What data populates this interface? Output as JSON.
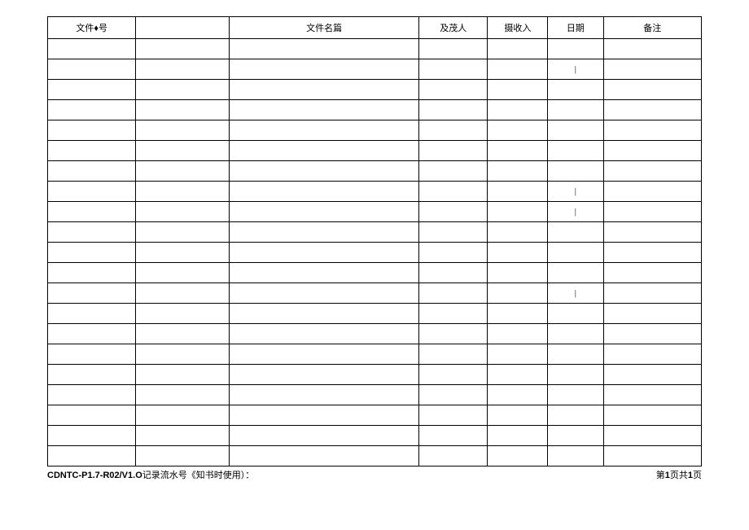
{
  "headers": {
    "fileno": "文件♦号",
    "spacer": "",
    "filename": "文件名篇",
    "jimao": "及茂人",
    "receiver": "摄收入",
    "date": "日期",
    "remark": "备注"
  },
  "rows": [
    {
      "fileno": "",
      "spacer": "",
      "filename": "",
      "jimao": "",
      "receiver": "",
      "date": "",
      "remark": ""
    },
    {
      "fileno": "",
      "spacer": "",
      "filename": "",
      "jimao": "",
      "receiver": "",
      "date": "|",
      "remark": ""
    },
    {
      "fileno": "",
      "spacer": "",
      "filename": "",
      "jimao": "",
      "receiver": "",
      "date": "",
      "remark": ""
    },
    {
      "fileno": "",
      "spacer": "",
      "filename": "",
      "jimao": "",
      "receiver": "",
      "date": "",
      "remark": ""
    },
    {
      "fileno": "",
      "spacer": "",
      "filename": "",
      "jimao": "",
      "receiver": "",
      "date": "",
      "remark": ""
    },
    {
      "fileno": "",
      "spacer": "",
      "filename": "",
      "jimao": "",
      "receiver": "",
      "date": "",
      "remark": ""
    },
    {
      "fileno": "",
      "spacer": "",
      "filename": "",
      "jimao": "",
      "receiver": "",
      "date": "",
      "remark": ""
    },
    {
      "fileno": "",
      "spacer": "",
      "filename": "",
      "jimao": "",
      "receiver": "",
      "date": "|",
      "remark": ""
    },
    {
      "fileno": "",
      "spacer": "",
      "filename": "",
      "jimao": "",
      "receiver": "",
      "date": "|",
      "remark": ""
    },
    {
      "fileno": "",
      "spacer": "",
      "filename": "",
      "jimao": "",
      "receiver": "",
      "date": "",
      "remark": ""
    },
    {
      "fileno": "",
      "spacer": "",
      "filename": "",
      "jimao": "",
      "receiver": "",
      "date": "",
      "remark": ""
    },
    {
      "fileno": "",
      "spacer": "",
      "filename": "",
      "jimao": "",
      "receiver": "",
      "date": "",
      "remark": ""
    },
    {
      "fileno": "",
      "spacer": "",
      "filename": "",
      "jimao": "",
      "receiver": "",
      "date": "|",
      "remark": ""
    },
    {
      "fileno": "",
      "spacer": "",
      "filename": "",
      "jimao": "",
      "receiver": "",
      "date": "",
      "remark": ""
    },
    {
      "fileno": "",
      "spacer": "",
      "filename": "",
      "jimao": "",
      "receiver": "",
      "date": "",
      "remark": ""
    },
    {
      "fileno": "",
      "spacer": "",
      "filename": "",
      "jimao": "",
      "receiver": "",
      "date": "",
      "remark": ""
    },
    {
      "fileno": "",
      "spacer": "",
      "filename": "",
      "jimao": "",
      "receiver": "",
      "date": "",
      "remark": ""
    },
    {
      "fileno": "",
      "spacer": "",
      "filename": "",
      "jimao": "",
      "receiver": "",
      "date": "",
      "remark": ""
    },
    {
      "fileno": "",
      "spacer": "",
      "filename": "",
      "jimao": "",
      "receiver": "",
      "date": "",
      "remark": ""
    },
    {
      "fileno": "",
      "spacer": "",
      "filename": "",
      "jimao": "",
      "receiver": "",
      "date": "",
      "remark": ""
    },
    {
      "fileno": "",
      "spacer": "",
      "filename": "",
      "jimao": "",
      "receiver": "",
      "date": "",
      "remark": ""
    }
  ],
  "footer": {
    "code": "CDNTC-P1.7-R02/V1.O",
    "note": "记录流水号《知书时使用）：",
    "page_prefix": "第",
    "page_num": "1",
    "page_mid": "页共",
    "page_total": "1",
    "page_suffix": "页"
  }
}
